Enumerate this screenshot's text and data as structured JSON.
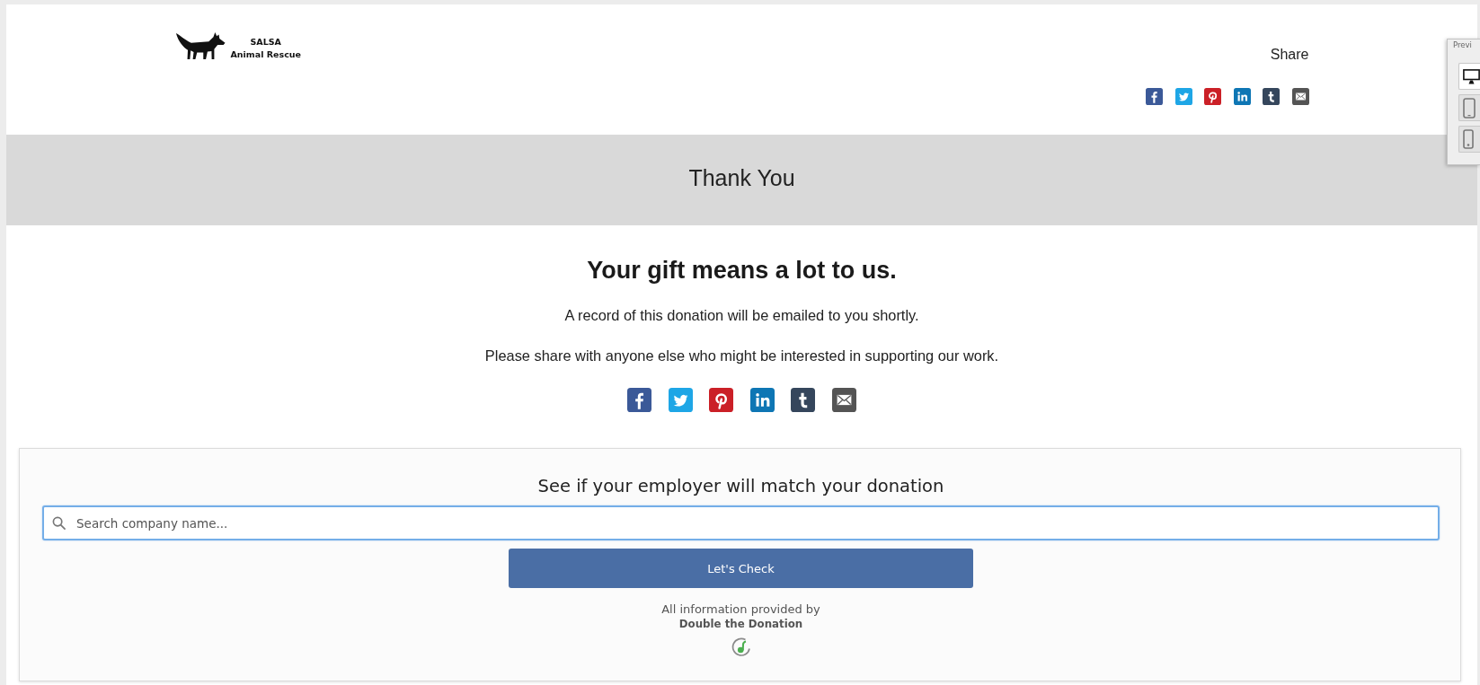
{
  "header": {
    "logo": {
      "title": "SALSA",
      "subtitle": "Animal Rescue"
    },
    "share": {
      "label": "Share",
      "links": [
        {
          "kind": "facebook"
        },
        {
          "kind": "twitter"
        },
        {
          "kind": "pinterest"
        },
        {
          "kind": "linkedin"
        },
        {
          "kind": "tumblr"
        },
        {
          "kind": "email"
        }
      ]
    }
  },
  "banner": {
    "title": "Thank You"
  },
  "message": {
    "heading": "Your gift means a lot to us.",
    "paragraphs": [
      "A record of this donation will be emailed to you shortly.",
      "Please share with anyone else who might be interested in supporting our work."
    ],
    "share_links": [
      {
        "kind": "facebook"
      },
      {
        "kind": "twitter"
      },
      {
        "kind": "pinterest"
      },
      {
        "kind": "linkedin"
      },
      {
        "kind": "tumblr"
      },
      {
        "kind": "email"
      }
    ]
  },
  "employer_match": {
    "heading": "See if your employer will match your donation",
    "search": {
      "placeholder": "Search company name...",
      "focused": true
    },
    "button": "Let's Check",
    "credit": "All information provided by",
    "provider": "Double the Donation"
  },
  "preview_panel": {
    "title": "Previ",
    "devices": [
      {
        "kind": "desktop",
        "selected": true
      },
      {
        "kind": "tablet",
        "selected": false
      },
      {
        "kind": "phone",
        "selected": false
      }
    ]
  }
}
